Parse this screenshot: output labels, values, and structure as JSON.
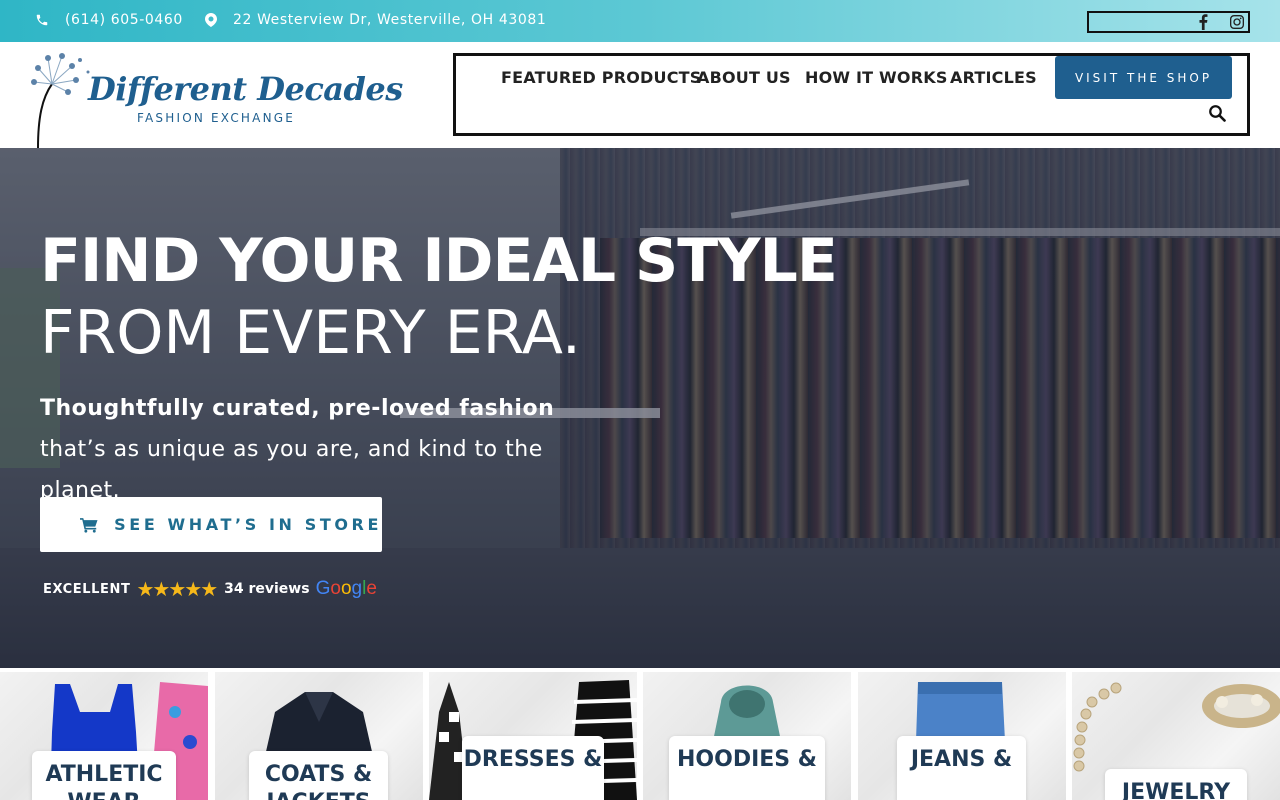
{
  "topbar": {
    "phone": "(614) 605-0460",
    "address": "22 Westerview Dr, Westerville, OH 43081",
    "social": [
      "facebook-icon",
      "instagram-icon"
    ]
  },
  "brand": {
    "name_line1": "Different Decades",
    "name_line2": "FASHION EXCHANGE"
  },
  "nav": {
    "items": [
      "FEATURED PRODUCTS",
      "ABOUT US",
      "HOW IT WORKS",
      "ARTICLES"
    ],
    "cta": "VISIT THE SHOP"
  },
  "hero": {
    "title_bold": "FIND YOUR IDEAL STYLE",
    "title_light": "FROM EVERY ERA.",
    "subtitle_bold": "Thoughtfully curated, pre-loved fashion",
    "subtitle_rest": " that’s as unique as you are, and kind to the planet.",
    "cta": "SEE WHAT’S IN STORE",
    "reviews": {
      "rating_text": "EXCELLENT",
      "stars": "★★★★★",
      "count": "34 reviews",
      "source": "Google"
    }
  },
  "categories": [
    {
      "label": "ATHLETIC WEAR"
    },
    {
      "label": "COATS & JACKETS"
    },
    {
      "label": "DRESSES &"
    },
    {
      "label": "HOODIES &"
    },
    {
      "label": "JEANS &"
    },
    {
      "label": "JEWELRY"
    }
  ],
  "colors": {
    "brand_blue": "#1f5f8f",
    "accent_teal": "#2fb6c6",
    "star": "#f6b81a"
  }
}
